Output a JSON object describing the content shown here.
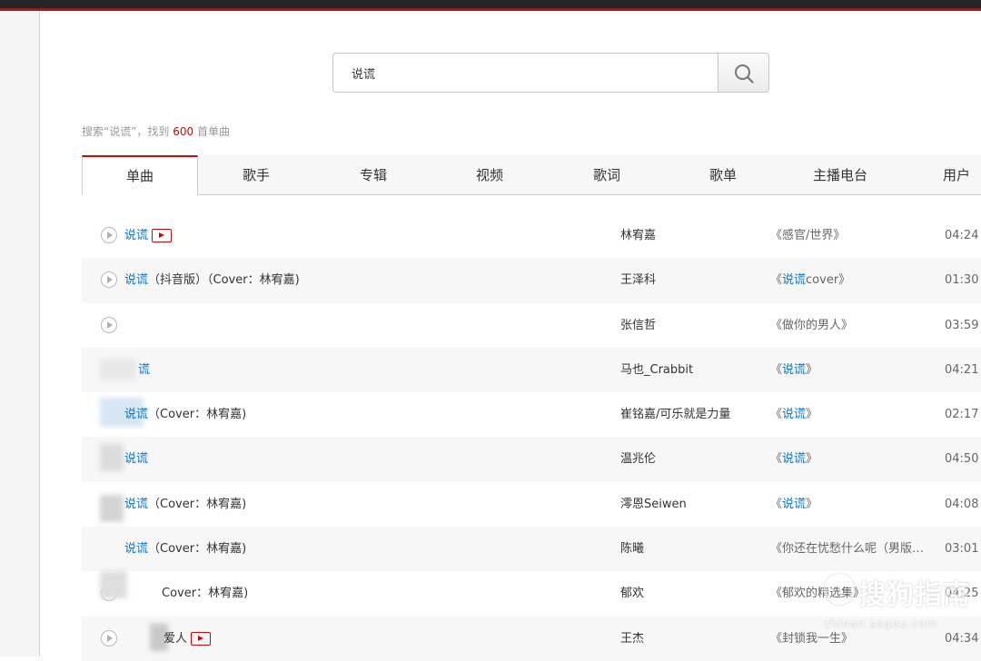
{
  "search": {
    "query": "说谎",
    "button_icon": "search-icon"
  },
  "summary": {
    "prefix": "搜索“说谎”，找到 ",
    "count": "600",
    "suffix": " 首单曲"
  },
  "tabs": [
    {
      "label": "单曲"
    },
    {
      "label": "歌手"
    },
    {
      "label": "专辑"
    },
    {
      "label": "视频"
    },
    {
      "label": "歌词"
    },
    {
      "label": "歌单"
    },
    {
      "label": "主播电台"
    },
    {
      "label": "用户"
    }
  ],
  "songs": [
    {
      "title_hl": "说谎",
      "title_rest": "",
      "mv": true,
      "artist": "林宥嘉",
      "album_pre": "《感官/世界》",
      "album_hl": "",
      "album_post": "",
      "duration": "04:24"
    },
    {
      "title_hl": "说谎",
      "title_rest": "（抖音版）（Cover：林宥嘉)",
      "mv": false,
      "artist": "王泽科",
      "album_pre": "《",
      "album_hl": "说谎",
      "album_post": "cover》",
      "duration": "01:30"
    },
    {
      "title_hl": "",
      "title_rest": "",
      "mv": false,
      "artist": "张信哲",
      "album_pre": "《做你的男人》",
      "album_hl": "",
      "album_post": "",
      "duration": "03:59"
    },
    {
      "title_hl": "谎",
      "title_rest": "",
      "mv": false,
      "artist": "马也_Crabbit",
      "album_pre": "《",
      "album_hl": "说谎",
      "album_post": "》",
      "duration": "04:21"
    },
    {
      "title_hl": "说谎",
      "title_rest": "（Cover：林宥嘉)",
      "mv": false,
      "artist": "崔铭嘉/可乐就是力量",
      "album_pre": "《",
      "album_hl": "说谎",
      "album_post": "》",
      "duration": "02:17"
    },
    {
      "title_hl": "说谎",
      "title_rest": "",
      "mv": false,
      "artist": "温兆伦",
      "album_pre": "《",
      "album_hl": "说谎",
      "album_post": "》",
      "duration": "04:50"
    },
    {
      "title_hl": "说谎",
      "title_rest": "（Cover：林宥嘉)",
      "mv": false,
      "artist": "澪恩Seiwen",
      "album_pre": "《",
      "album_hl": "说谎",
      "album_post": "》",
      "duration": "04:08"
    },
    {
      "title_hl": "说谎",
      "title_rest": "（Cover：林宥嘉)",
      "mv": false,
      "artist": "陈曦",
      "album_pre": "《你还在忧愁什么呢（男版…",
      "album_hl": "",
      "album_post": "",
      "duration": "03:01"
    },
    {
      "title_hl": "",
      "title_rest": "Cover：林宥嘉)",
      "mv": false,
      "artist": "郁欢",
      "album_pre": "《郁欢的精选集》",
      "album_hl": "",
      "album_post": "",
      "duration": "04:25"
    },
    {
      "title_hl": "",
      "title_rest": "爱人",
      "mv": true,
      "artist": "王杰",
      "album_pre": "《封锁我一生》",
      "album_hl": "",
      "album_post": "",
      "duration": "04:34"
    }
  ],
  "watermark": {
    "main": "搜狗指南",
    "sub": "zhinan.sogou.com"
  }
}
